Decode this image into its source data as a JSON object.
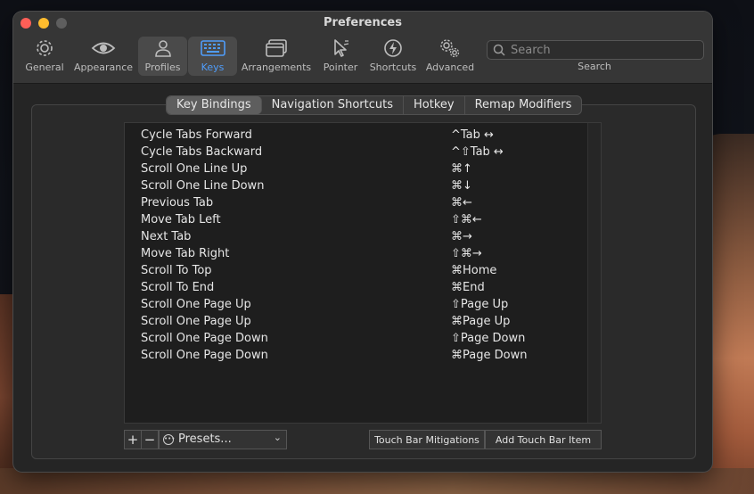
{
  "window": {
    "title": "Preferences"
  },
  "toolbar": [
    {
      "id": "general",
      "label": "General",
      "icon": "gear-icon"
    },
    {
      "id": "appearance",
      "label": "Appearance",
      "icon": "eye-icon"
    },
    {
      "id": "profiles",
      "label": "Profiles",
      "icon": "person-icon"
    },
    {
      "id": "keys",
      "label": "Keys",
      "icon": "keyboard-icon"
    },
    {
      "id": "arrangements",
      "label": "Arrangements",
      "icon": "windows-icon"
    },
    {
      "id": "pointer",
      "label": "Pointer",
      "icon": "cursor-icon"
    },
    {
      "id": "shortcuts",
      "label": "Shortcuts",
      "icon": "bolt-icon"
    },
    {
      "id": "advanced",
      "label": "Advanced",
      "icon": "gears-icon"
    }
  ],
  "search": {
    "placeholder": "Search",
    "label": "Search"
  },
  "tabs": [
    "Key Bindings",
    "Navigation Shortcuts",
    "Hotkey",
    "Remap Modifiers"
  ],
  "selected_tab": "Key Bindings",
  "bindings": [
    {
      "action": "Cycle Tabs Forward",
      "key": "^Tab ↔"
    },
    {
      "action": "Cycle Tabs Backward",
      "key": "^⇧Tab ↔"
    },
    {
      "action": "Scroll One Line Up",
      "key": "⌘↑"
    },
    {
      "action": "Scroll One Line Down",
      "key": "⌘↓"
    },
    {
      "action": "Previous Tab",
      "key": "⌘←"
    },
    {
      "action": "Move Tab Left",
      "key": "⇧⌘←"
    },
    {
      "action": "Next Tab",
      "key": "⌘→"
    },
    {
      "action": "Move Tab Right",
      "key": "⇧⌘→"
    },
    {
      "action": "Scroll To Top",
      "key": "⌘Home"
    },
    {
      "action": "Scroll To End",
      "key": "⌘End"
    },
    {
      "action": "Scroll One Page Up",
      "key": "⇧Page Up"
    },
    {
      "action": "Scroll One Page Up",
      "key": "⌘Page Up"
    },
    {
      "action": "Scroll One Page Down",
      "key": "⇧Page Down"
    },
    {
      "action": "Scroll One Page Down",
      "key": "⌘Page Down"
    }
  ],
  "footer": {
    "add_label": "+",
    "remove_label": "−",
    "presets_label": "Presets...",
    "touch_bar_mitigations": "Touch Bar Mitigations",
    "add_touch_bar_item": "Add Touch Bar Item"
  },
  "colors": {
    "accent": "#4f9cf9",
    "window_bg": "#252525",
    "toolbar_bg": "#363636"
  }
}
